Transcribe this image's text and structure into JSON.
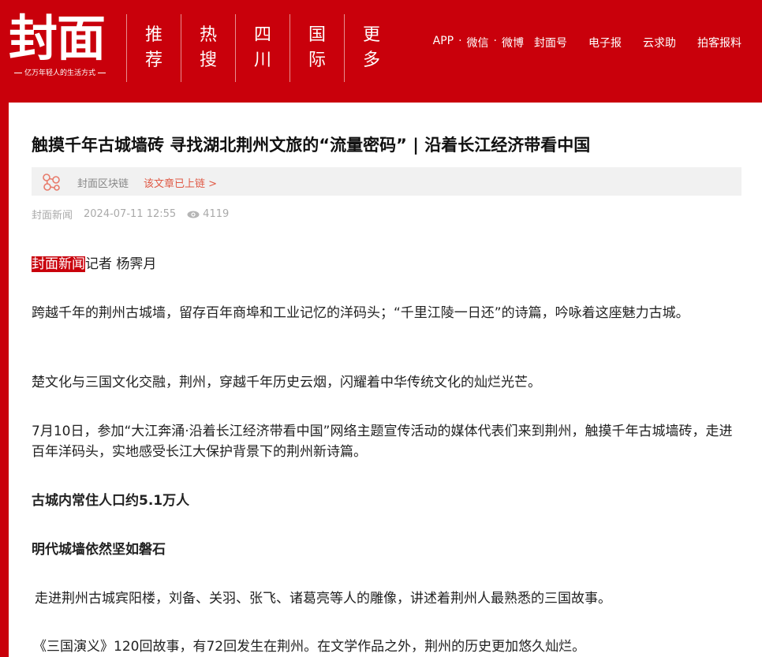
{
  "header": {
    "logo": "封面",
    "slogan": "亿万年轻人的生活方式",
    "nav": [
      {
        "top": "推",
        "bottom": "荐"
      },
      {
        "top": "热",
        "bottom": "搜"
      },
      {
        "top": "四",
        "bottom": "川"
      },
      {
        "top": "国",
        "bottom": "际"
      },
      {
        "top": "更",
        "bottom": "多"
      }
    ],
    "links": {
      "app": "APP",
      "wechat": "微信",
      "weibo": "微博",
      "sep": "·",
      "fengmianhao": "封面号",
      "epaper": "电子报",
      "help": "云求助",
      "report": "拍客报料"
    }
  },
  "article": {
    "title": "触摸千年古城墙砖 寻找湖北荆州文旅的“流量密码” | 沿着长江经济带看中国",
    "chain_label": "封面区块链",
    "chain_link": "该文章已上链 >",
    "source": "封面新闻",
    "date": "2024-07-11 12:55",
    "views": "4119",
    "byline_highlight": "封面新闻",
    "byline_rest": "记者 杨霁月",
    "paragraphs": [
      "跨越千年的荆州古城墙，留存百年商埠和工业记忆的洋码头；“千里江陵一日还”的诗篇，吟咏着这座魅力古城。",
      "楚文化与三国文化交融，荆州，穿越千年历史云烟，闪耀着中华传统文化的灿烂光芒。",
      "7月10日，参加“大江奔涌·沿着长江经济带看中国”网络主题宣传活动的媒体代表们来到荆州，触摸千年古城墙砖，走进百年洋码头，实地感受长江大保护背景下的荆州新诗篇。"
    ],
    "heading1": "古城内常住人口约5.1万人",
    "heading2": "明代城墙依然坚如磐石",
    "paragraph4": "走进荆州古城宾阳楼，刘备、关羽、张飞、诸葛亮等人的雕像，讲述着荆州人最熟悉的三国故事。",
    "paragraph5": "《三国演义》120回故事，有72回发生在荆州。在文学作品之外，荆州的历史更加悠久灿烂。"
  },
  "colors": {
    "brand_red": "#c9000b",
    "link_orange": "#e05a46",
    "meta_gray": "#aaaaaa"
  },
  "icons": {
    "chain": "blockchain-icon",
    "views": "eye-icon"
  }
}
